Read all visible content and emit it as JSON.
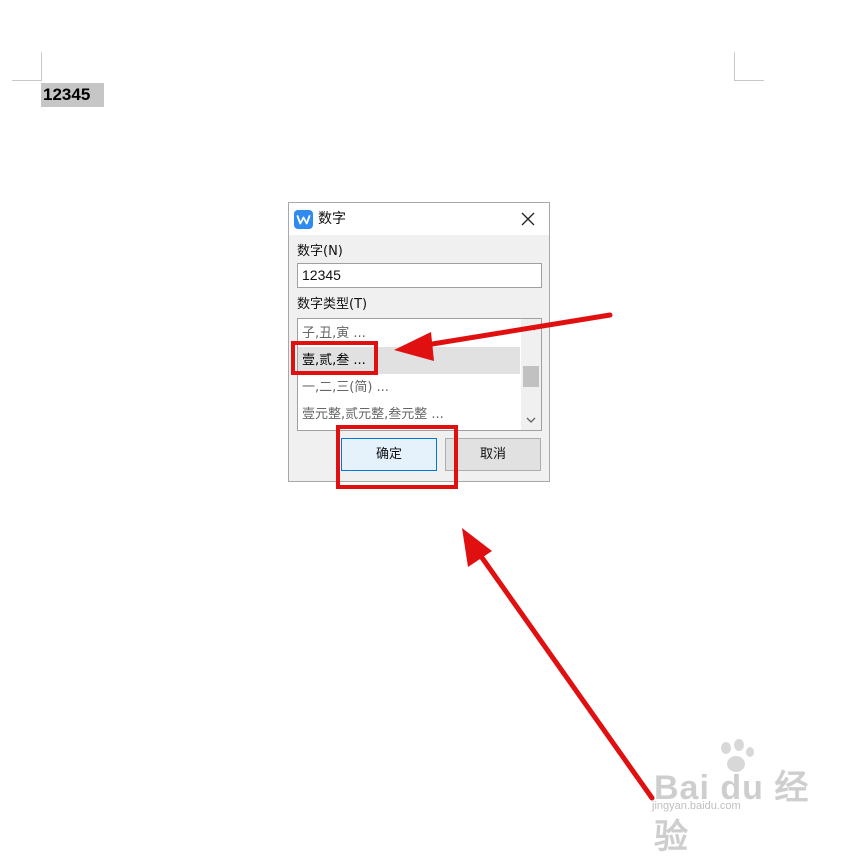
{
  "document": {
    "selected_text": "12345"
  },
  "dialog": {
    "title": "数字",
    "close_icon": "close-icon",
    "number_label": "数字(N)",
    "number_value": "12345",
    "type_label": "数字类型(T)",
    "type_options": [
      "子,丑,寅 ...",
      "壹,贰,叁 ...",
      "一,二,三(简) ...",
      "壹元整,贰元整,叁元整 ..."
    ],
    "selected_type": "壹,贰,叁 ...",
    "ok_label": "确定",
    "cancel_label": "取消"
  },
  "annotation": {
    "color": "#e01010"
  },
  "watermark": {
    "brand": "Bai du 经验",
    "url": "jingyan.baidu.com"
  }
}
